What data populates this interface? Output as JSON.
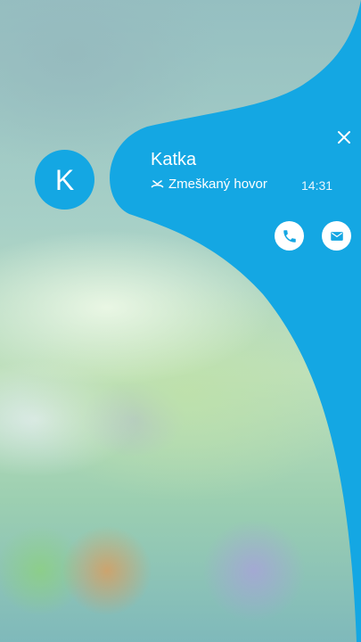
{
  "contact": {
    "initial": "K",
    "name": "Katka",
    "status": "Zmeškaný hovor",
    "time": "14:31"
  },
  "icons": {
    "close": "close-icon",
    "missed_call": "missed-call-icon",
    "call": "phone-icon",
    "message": "message-icon"
  },
  "colors": {
    "accent": "#14a7e3",
    "text_on_accent": "#ffffff",
    "button_bg": "#ffffff"
  }
}
